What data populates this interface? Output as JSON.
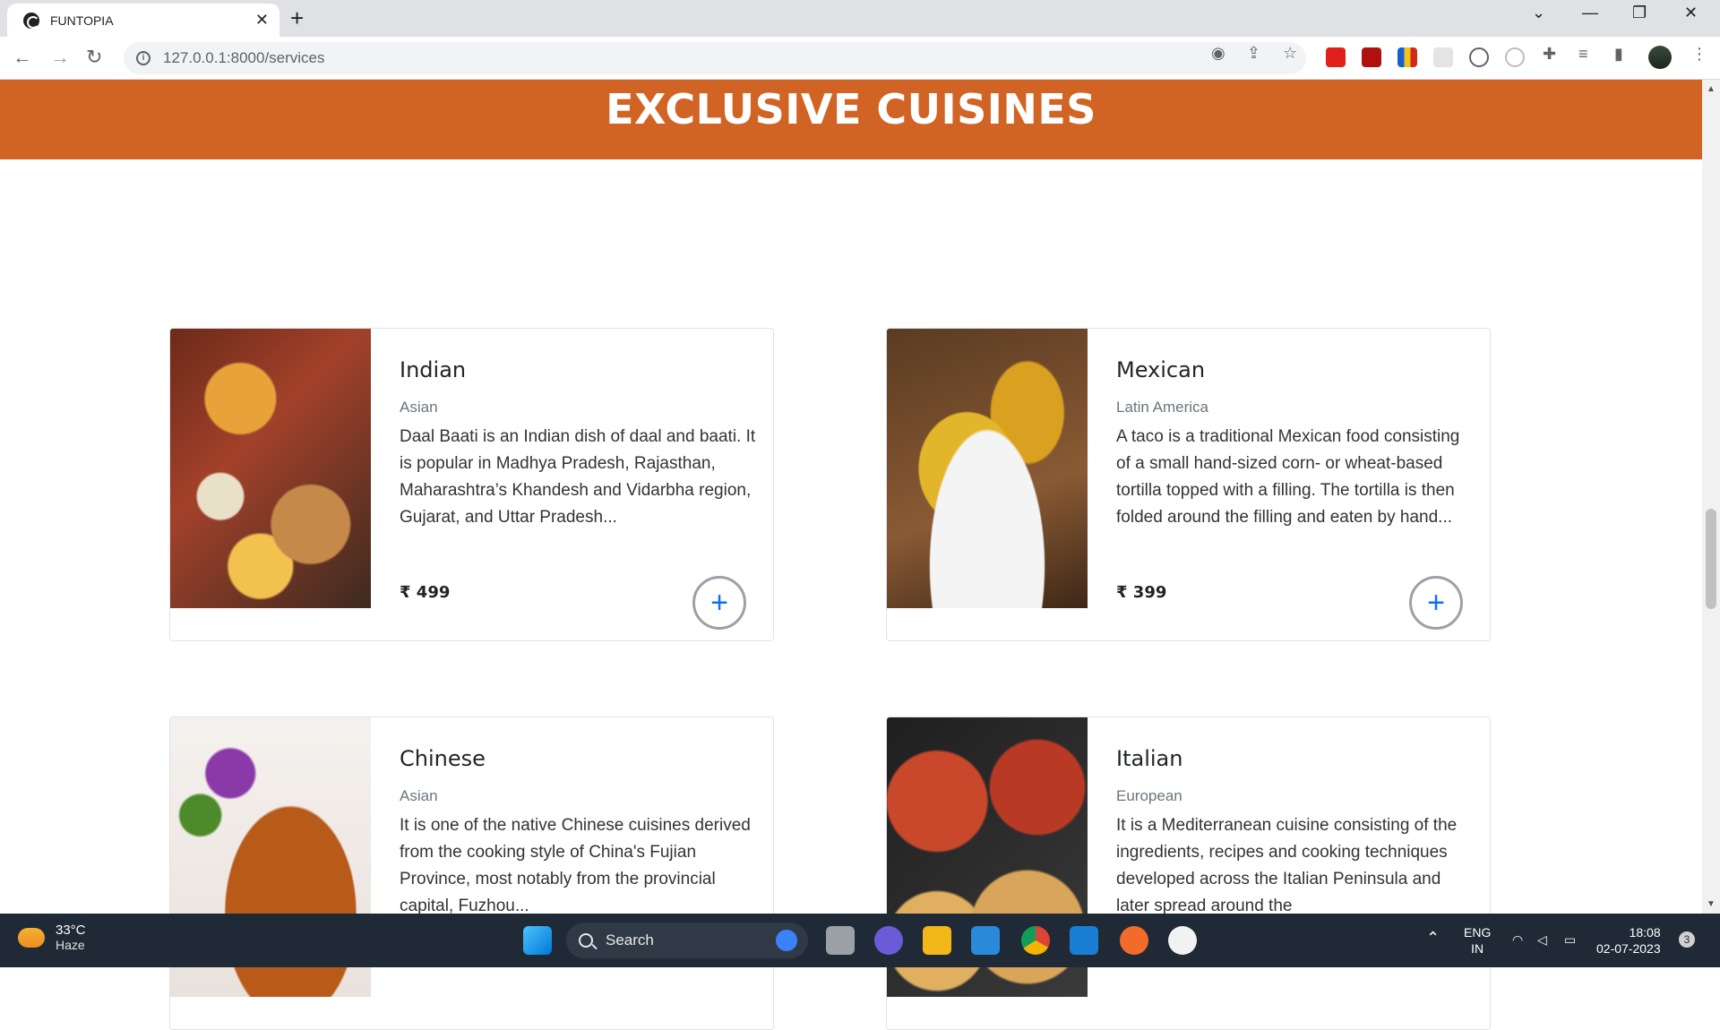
{
  "browser": {
    "tab_title": "FUNTOPIA",
    "tab_close": "✕",
    "new_tab": "+",
    "url": "127.0.0.1:8000/services",
    "controls": {
      "tabs_list": "⌄",
      "minimize": "—",
      "restore": "❐",
      "close": "✕"
    },
    "nav": {
      "back": "←",
      "forward": "→",
      "reload": "↻"
    }
  },
  "page": {
    "banner_title": "EXCLUSIVE CUISINES",
    "add_label": "+",
    "cards": [
      {
        "name": "Indian",
        "region": "Asian",
        "description": "Daal Baati is an Indian dish of daal and baati. It is popular in Madhya Pradesh, Rajasthan, Maharashtra’s Khandesh and Vidarbha region, Gujarat, and Uttar Pradesh...",
        "price": "₹ 499",
        "image": "indian-thali-image"
      },
      {
        "name": "Mexican",
        "region": "Latin America",
        "description": "A taco is a traditional Mexican food consisting of a small hand-sized corn- or wheat-based tortilla topped with a filling. The tortilla is then folded around the filling and eaten by hand...",
        "price": "₹ 399",
        "image": "tacos-image"
      },
      {
        "name": "Chinese",
        "region": "Asian",
        "description": "It is one of the native Chinese cuisines derived from the cooking style of China's Fujian Province, most notably from the provincial capital, Fuzhou...",
        "price": "",
        "image": "roast-duck-image"
      },
      {
        "name": "Italian",
        "region": "European",
        "description": "It is a Mediterranean cuisine consisting of the ingredients, recipes and cooking techniques developed across the Italian Peninsula and later spread around the",
        "price": "",
        "image": "pizza-image"
      }
    ]
  },
  "taskbar": {
    "temperature": "33°C",
    "weather": "Haze",
    "search_label": "Search",
    "language": "ENG",
    "region": "IN",
    "time": "18:08",
    "date": "02-07-2023",
    "notification_count": "3"
  },
  "colors": {
    "banner": "#d16325",
    "accent": "#0d6efd"
  }
}
